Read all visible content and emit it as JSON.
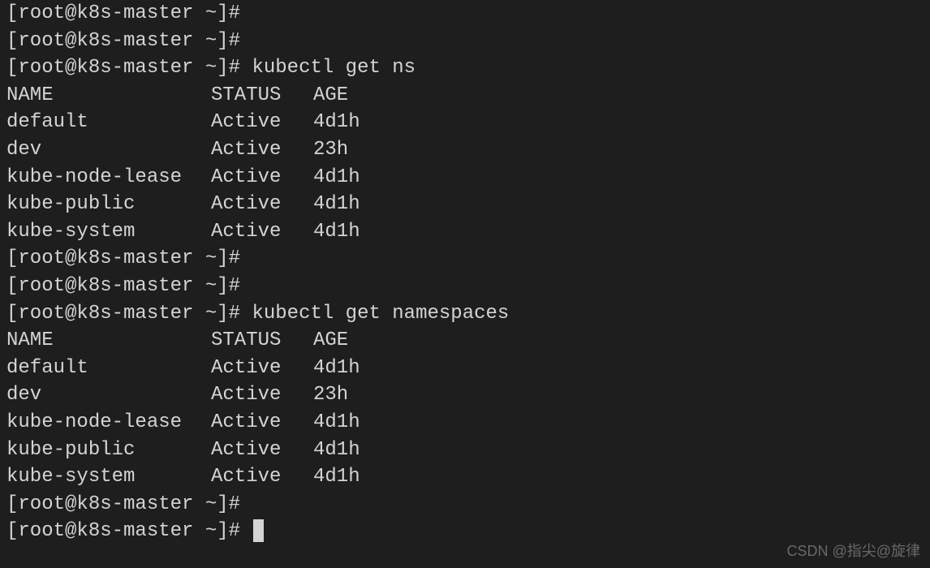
{
  "prompt": "[root@k8s-master ~]#",
  "commands": {
    "cmd1": "kubectl get ns",
    "cmd2": "kubectl get namespaces"
  },
  "table_headers": {
    "name": "NAME",
    "status": "STATUS",
    "age": "AGE"
  },
  "namespaces": [
    {
      "name": "default",
      "status": "Active",
      "age": "4d1h"
    },
    {
      "name": "dev",
      "status": "Active",
      "age": "23h"
    },
    {
      "name": "kube-node-lease",
      "status": "Active",
      "age": "4d1h"
    },
    {
      "name": "kube-public",
      "status": "Active",
      "age": "4d1h"
    },
    {
      "name": "kube-system",
      "status": "Active",
      "age": "4d1h"
    }
  ],
  "watermark": "CSDN @指尖@旋律"
}
